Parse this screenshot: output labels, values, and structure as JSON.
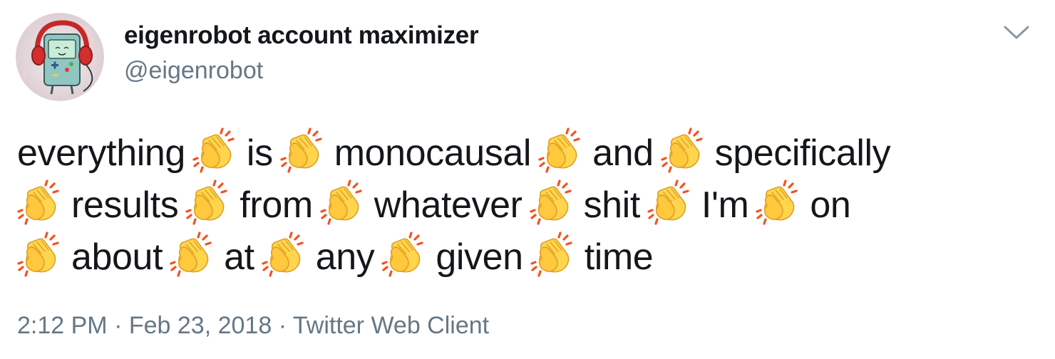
{
  "author": {
    "display_name": "eigenrobot account maximizer",
    "handle": "@eigenrobot"
  },
  "tweet": {
    "lines": [
      [
        "everything",
        "is",
        "monocausal",
        "and",
        "specifically"
      ],
      [
        "results",
        "from",
        "whatever",
        "shit",
        "I'm",
        "on"
      ],
      [
        "about",
        "at",
        "any",
        "given",
        "time"
      ]
    ],
    "separator_icon": "clapping-hands-emoji"
  },
  "meta": {
    "time": "2:12 PM",
    "date": "Feb 23, 2018",
    "client": "Twitter Web Client",
    "separator": "·"
  },
  "colors": {
    "text": "#14171a",
    "secondary": "#657786",
    "clap_skin": "#FFC83D",
    "clap_motion": "#F4511E"
  },
  "icons": {
    "menu_caret": "chevron-down-icon",
    "avatar": "bmo-with-headphones-avatar"
  }
}
